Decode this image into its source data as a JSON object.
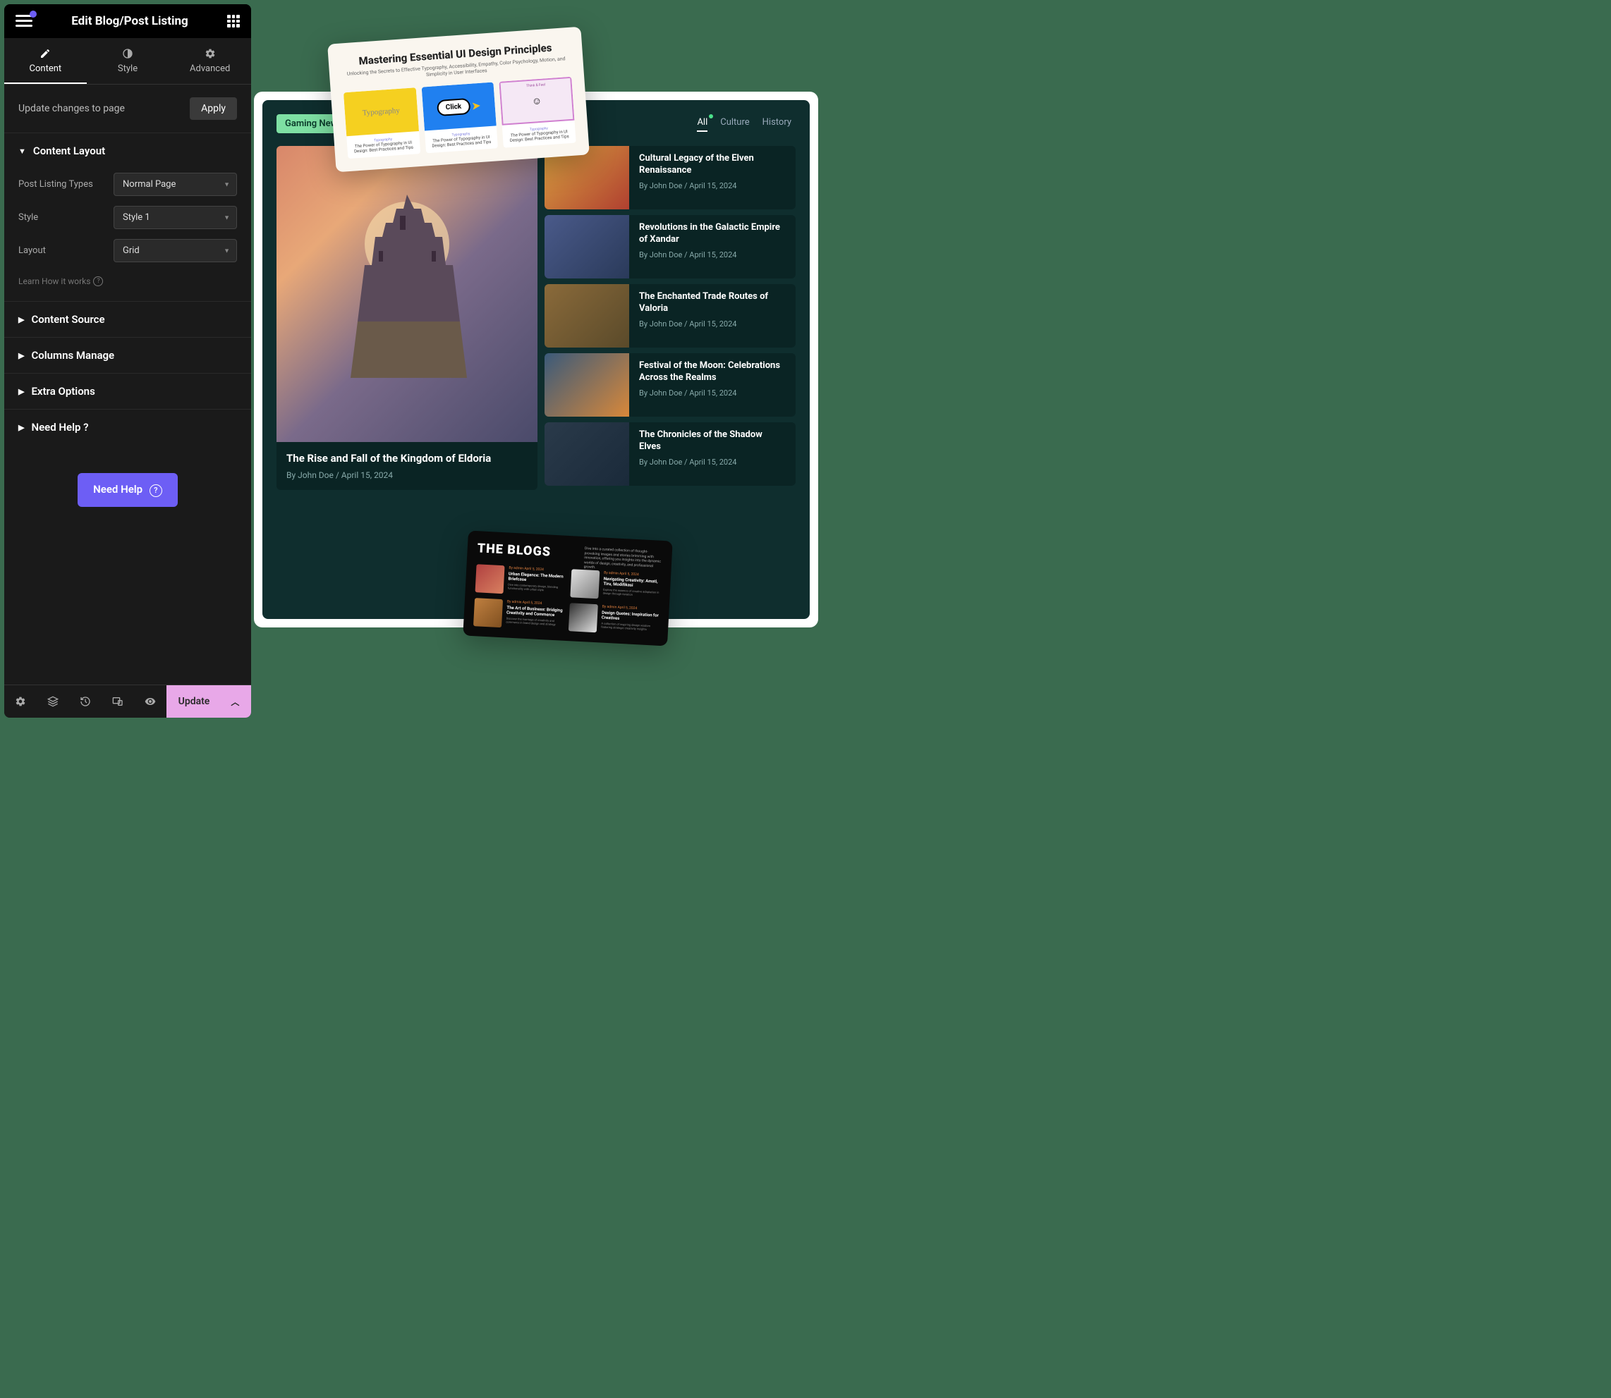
{
  "sidebar": {
    "title": "Edit Blog/Post Listing",
    "tabs": {
      "content": "Content",
      "style": "Style",
      "advanced": "Advanced"
    },
    "update_changes": "Update changes to page",
    "apply": "Apply",
    "sections": {
      "content_layout": {
        "title": "Content Layout",
        "post_listing_types": {
          "label": "Post Listing Types",
          "value": "Normal Page"
        },
        "style": {
          "label": "Style",
          "value": "Style 1"
        },
        "layout": {
          "label": "Layout",
          "value": "Grid"
        },
        "learn": "Learn How it works"
      },
      "content_source": "Content Source",
      "columns_manage": "Columns Manage",
      "extra_options": "Extra Options",
      "need_help": "Need Help ?"
    },
    "need_help_btn": "Need Help",
    "bottom": {
      "update": "Update"
    }
  },
  "preview": {
    "badge": "Gaming News",
    "filters": {
      "all": "All",
      "culture": "Culture",
      "history": "History"
    },
    "main_post": {
      "title": "The Rise and Fall of the Kingdom of Eldoria",
      "meta": "By John Doe / April 15, 2024"
    },
    "side_posts": [
      {
        "title": "Cultural Legacy of the Elven Renaissance",
        "meta": "By John Doe / April 15, 2024"
      },
      {
        "title": "Revolutions in the Galactic Empire of Xandar",
        "meta": "By John Doe / April 15, 2024"
      },
      {
        "title": "The Enchanted Trade Routes of Valoria",
        "meta": "By John Doe / April 15, 2024"
      },
      {
        "title": "Festival of the Moon: Celebrations Across the Realms",
        "meta": "By John Doe / April 15, 2024"
      },
      {
        "title": "The Chronicles of the Shadow Elves",
        "meta": "By John Doe / April 15, 2024"
      }
    ]
  },
  "float_top": {
    "title": "Mastering Essential UI Design Principles",
    "subtitle": "Unlocking the Secrets to Effective Typography, Accessibility, Empathy, Color Psychology, Motion, and Simplicity in User Interfaces",
    "cards": [
      {
        "cat": "Typography",
        "title": "The Power of Typography in UI Design: Best Practices and Tips",
        "label": "Typography"
      },
      {
        "cat": "Typography",
        "title": "The Power of Typography in UI Design: Best Practices and Tips",
        "label": "Click"
      },
      {
        "cat": "Typography",
        "title": "The Power of Typography in UI Design: Best Practices and Tips",
        "label": "Think & Feel"
      }
    ]
  },
  "float_bottom": {
    "title": "THE BLOGS",
    "desc": "Dive into a curated collection of thought-provoking images and stories brimming with innovation, offering you insights into the dynamic worlds of design, creativity, and professional growth.",
    "items": [
      {
        "by": "By admin April 5, 2024",
        "title": "Urban Elegance: The Modern Briefcase",
        "desc": "Dive into contemporary design, blending functionality with urban style"
      },
      {
        "by": "By admin April 5, 2024",
        "title": "Navigating Creativity: Amati, Tiru, Modifikasi",
        "desc": "Explore the essence of creative adaptation in design through iteration"
      },
      {
        "by": "By admin April 5, 2024",
        "title": "The Art of Business: Bridging Creativity and Commerce",
        "desc": "Discover the marriage of creativity and commerce in brand design and strategy"
      },
      {
        "by": "By admin April 5, 2024",
        "title": "Design Quotes: Inspiration for Creatives",
        "desc": "A collection of inspiring design wisdom featuring strategic creativity insights"
      }
    ]
  }
}
